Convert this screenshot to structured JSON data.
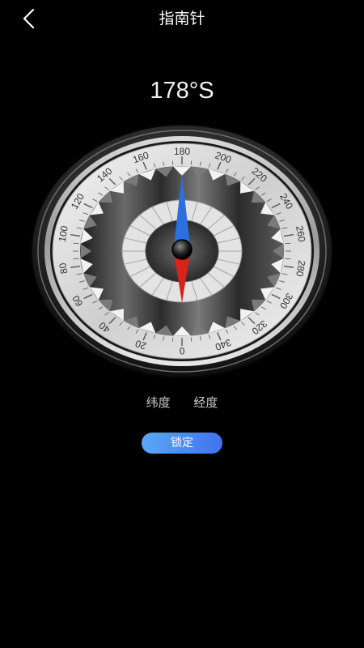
{
  "header": {
    "title": "指南针",
    "back_icon": "chevron-left-icon"
  },
  "compass": {
    "heading": "178°S",
    "heading_degrees": 178,
    "dial_labels": [
      "180",
      "200",
      "220",
      "240",
      "260",
      "280",
      "300",
      "320",
      "340",
      "0",
      "20",
      "40",
      "60",
      "80",
      "100",
      "120",
      "140",
      "160"
    ],
    "needle_north_color": "#2b6fe0",
    "needle_south_color": "#d8231b"
  },
  "coordinates": {
    "latitude_label": "纬度",
    "longitude_label": "经度"
  },
  "actions": {
    "lock_label": "锁定"
  },
  "colors": {
    "background": "#000000",
    "button_gradient_start": "#5aa8f4",
    "button_gradient_end": "#3f73ee"
  }
}
